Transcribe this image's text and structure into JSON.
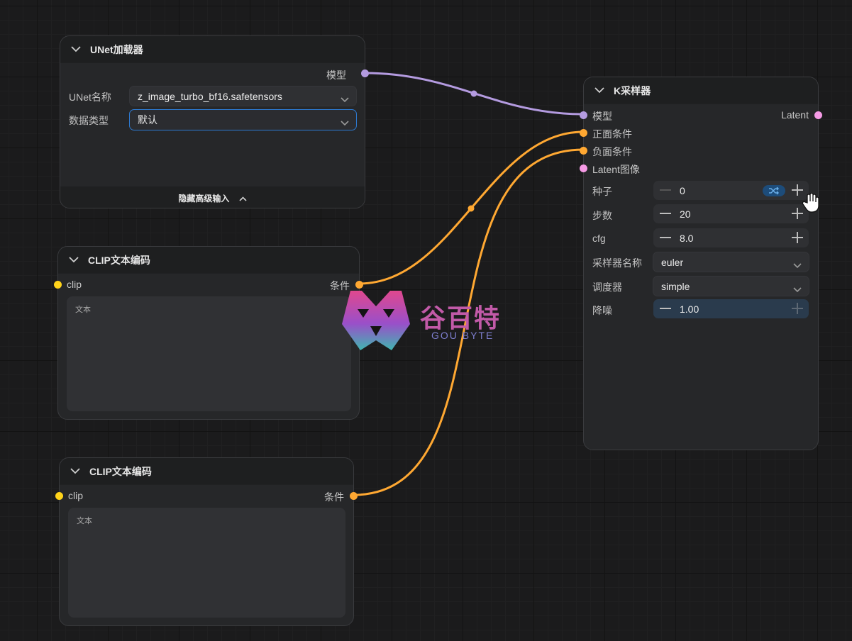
{
  "nodes": {
    "unet_loader": {
      "title": "UNet加载器",
      "output_label": "模型",
      "widgets": {
        "unet_name_label": "UNet名称",
        "unet_name_value": "z_image_turbo_bf16.safetensors",
        "dtype_label": "数据类型",
        "dtype_value": "默认"
      },
      "advanced_toggle": "隐藏高级输入"
    },
    "clip_encode_1": {
      "title": "CLIP文本编码",
      "input_label": "clip",
      "output_label": "条件",
      "text_placeholder": "文本"
    },
    "clip_encode_2": {
      "title": "CLIP文本编码",
      "input_label": "clip",
      "output_label": "条件",
      "text_placeholder": "文本"
    },
    "ksampler": {
      "title": "K采样器",
      "inputs": [
        "模型",
        "正面条件",
        "负面条件",
        "Latent图像"
      ],
      "output_label": "Latent",
      "widgets": {
        "seed_label": "种子",
        "seed_value": "0",
        "steps_label": "步数",
        "steps_value": "20",
        "cfg_label": "cfg",
        "cfg_value": "8.0",
        "sampler_label": "采样器名称",
        "sampler_value": "euler",
        "scheduler_label": "调度器",
        "scheduler_value": "simple",
        "denoise_label": "降噪",
        "denoise_value": "1.00"
      }
    }
  },
  "watermark": {
    "title": "谷百特",
    "subtitle": "GOU BYTE"
  },
  "colors": {
    "model_wire": "#b49be0",
    "conditioning_wire": "#ffa832",
    "clip_slot": "#ffd31a",
    "latent_slot": "#f59ae5",
    "focus_border": "#2d7ad1"
  },
  "icons": [
    "chevron-down-icon",
    "chevron-up-icon",
    "shuffle-icon",
    "hand-cursor-icon"
  ]
}
